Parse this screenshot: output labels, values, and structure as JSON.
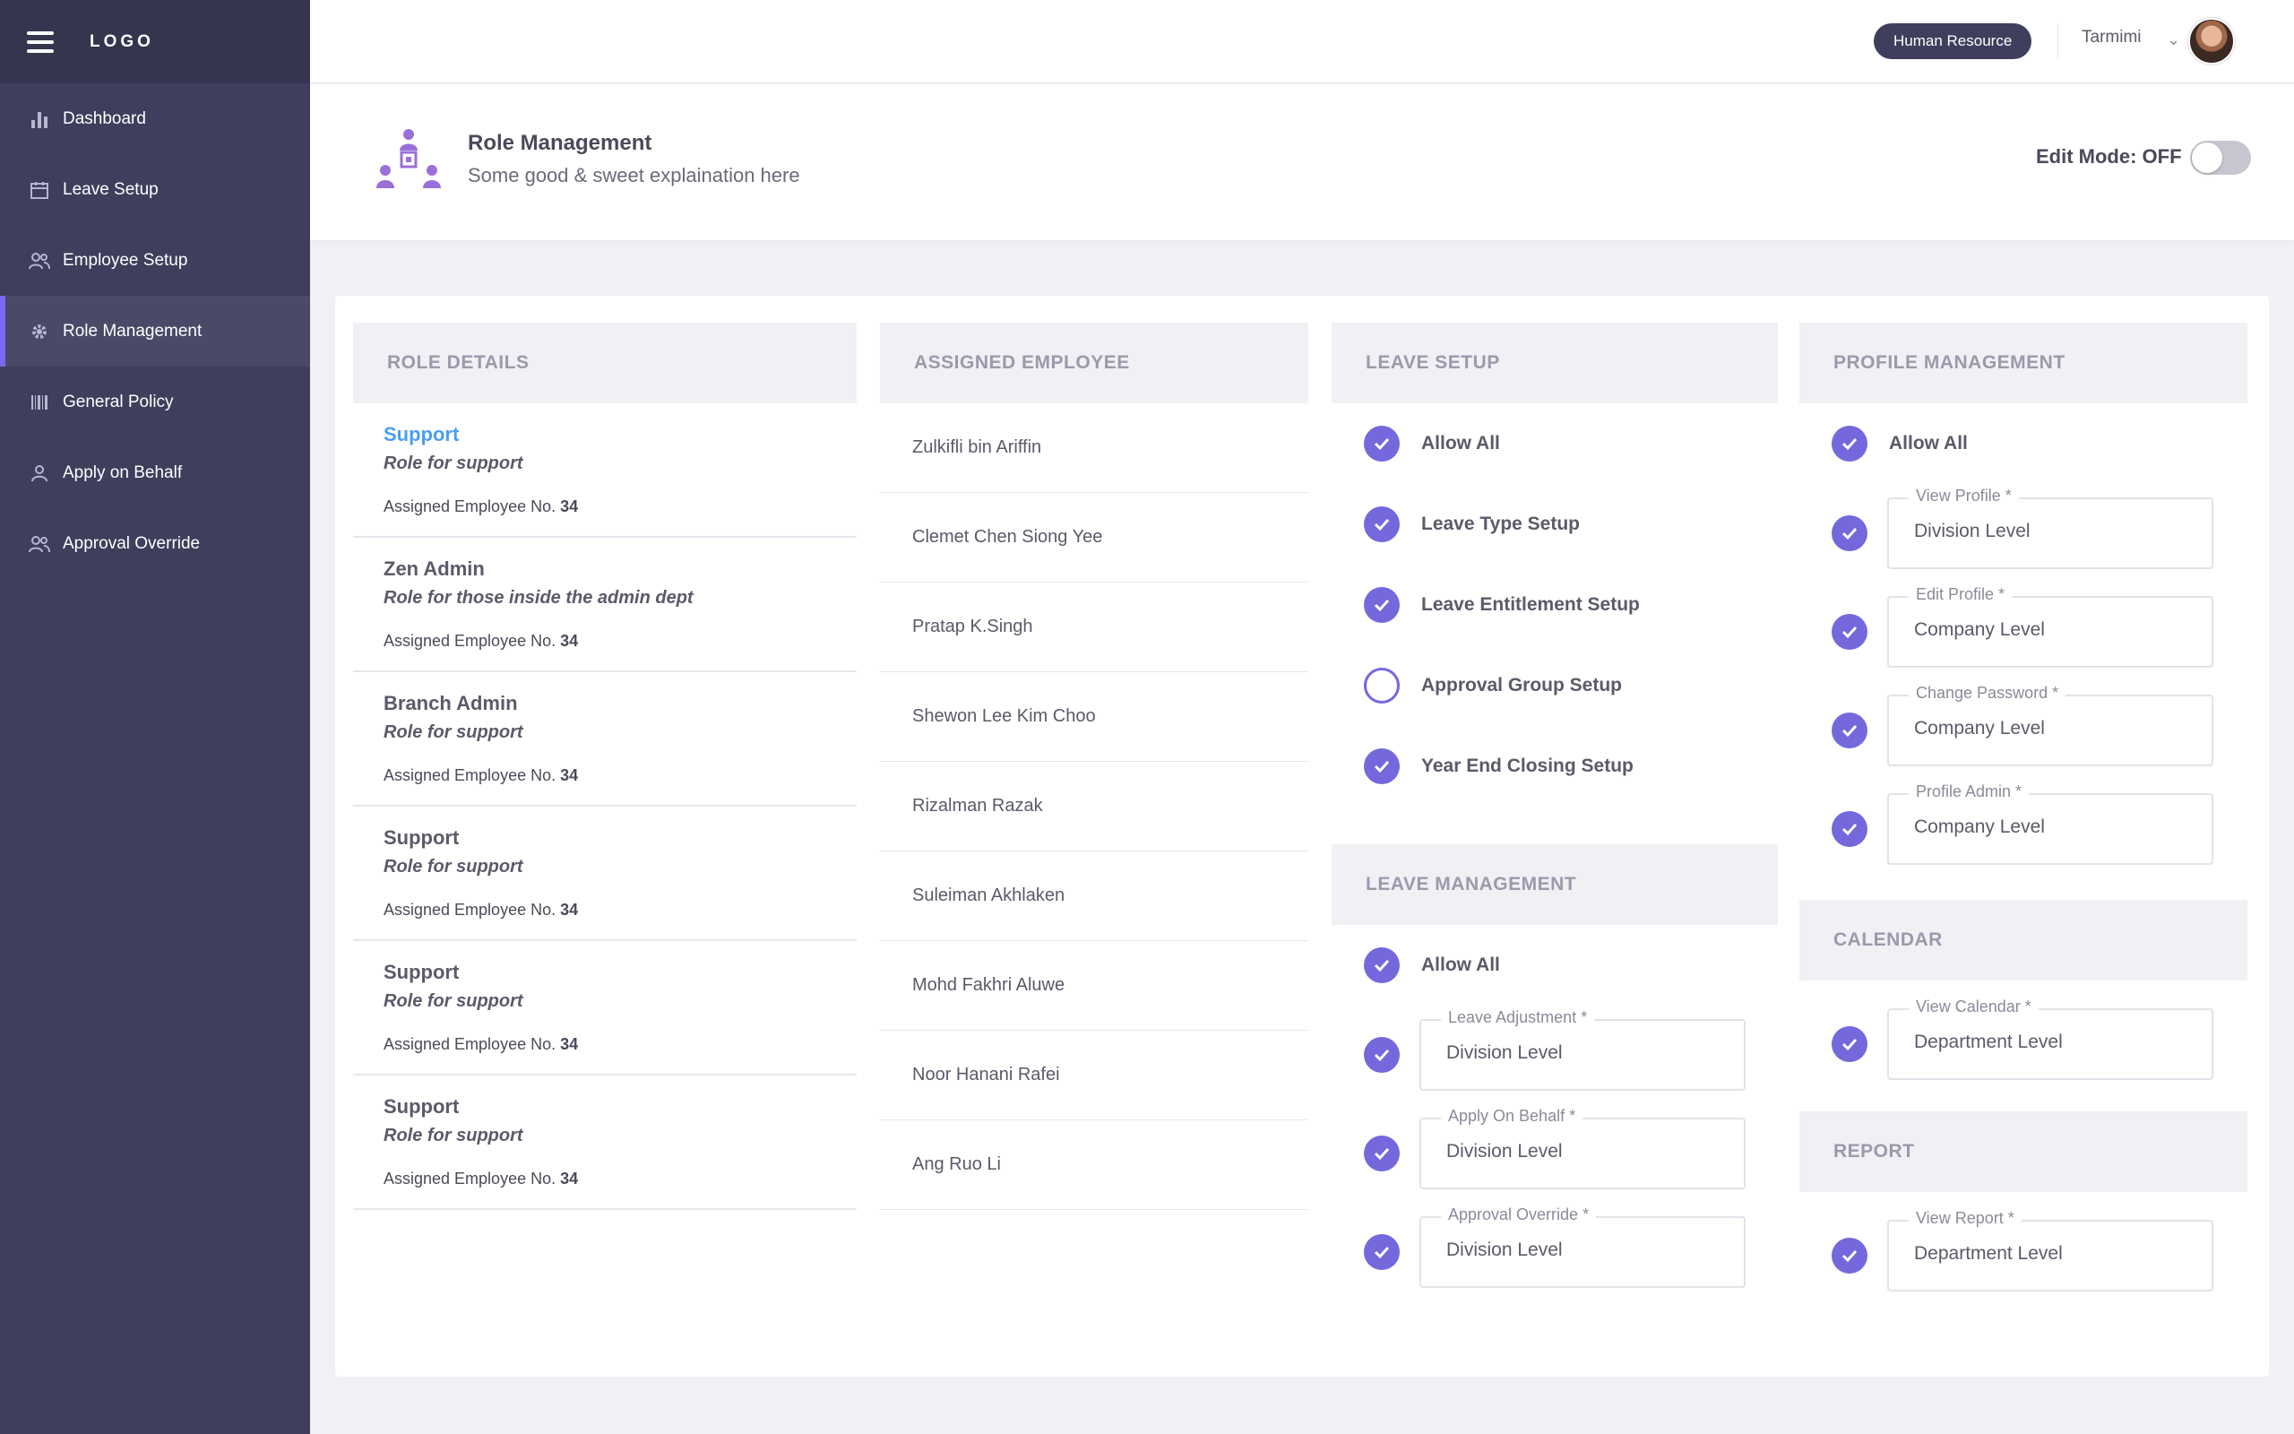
{
  "sidebar": {
    "logo": "LOGO",
    "items": [
      {
        "label": "Dashboard",
        "icon": "bar-chart-icon"
      },
      {
        "label": "Leave Setup",
        "icon": "calendar-icon"
      },
      {
        "label": "Employee Setup",
        "icon": "users-icon"
      },
      {
        "label": "Role Management",
        "icon": "gear-icon",
        "active": true
      },
      {
        "label": "General Policy",
        "icon": "barcode-icon"
      },
      {
        "label": "Apply on Behalf",
        "icon": "user-icon"
      },
      {
        "label": "Approval Override",
        "icon": "users-icon"
      }
    ]
  },
  "topbar": {
    "department": "Human Resource",
    "user_name": "Tarmimi"
  },
  "header": {
    "title": "Role Management",
    "subtitle": "Some good & sweet explaination here",
    "edit_mode_label": "Edit Mode: OFF"
  },
  "role_details": {
    "heading": "ROLE DETAILS",
    "count_label": "Assigned Employee No.",
    "roles": [
      {
        "name": "Support",
        "desc": "Role for support",
        "count": "34",
        "selected": true
      },
      {
        "name": "Zen Admin",
        "desc": "Role for those inside the admin dept",
        "count": "34"
      },
      {
        "name": "Branch Admin",
        "desc": "Role for support",
        "count": "34"
      },
      {
        "name": "Support",
        "desc": "Role for support",
        "count": "34"
      },
      {
        "name": "Support",
        "desc": "Role for support",
        "count": "34"
      },
      {
        "name": "Support",
        "desc": "Role for support",
        "count": "34"
      }
    ]
  },
  "assigned_employee": {
    "heading": "ASSIGNED EMPLOYEE",
    "employees": [
      "Zulkifli bin Ariffin",
      "Clemet Chen Siong Yee",
      "Pratap K.Singh",
      "Shewon Lee Kim Choo",
      "Rizalman Razak",
      "Suleiman Akhlaken",
      "Mohd Fakhri Aluwe",
      "Noor Hanani Rafei",
      "Ang Ruo Li"
    ]
  },
  "leave_setup": {
    "heading": "LEAVE SETUP",
    "items": [
      {
        "label": "Allow All",
        "checked": true
      },
      {
        "label": "Leave Type Setup",
        "checked": true
      },
      {
        "label": "Leave Entitlement Setup",
        "checked": true
      },
      {
        "label": "Approval Group Setup",
        "checked": false
      },
      {
        "label": "Year End Closing Setup",
        "checked": true
      }
    ]
  },
  "leave_management": {
    "heading": "LEAVE MANAGEMENT",
    "allow_all": "Allow All",
    "fields": [
      {
        "label": "Leave Adjustment *",
        "value": "Division Level"
      },
      {
        "label": "Apply On Behalf *",
        "value": "Division Level"
      },
      {
        "label": "Approval Override *",
        "value": "Division Level"
      }
    ]
  },
  "profile_management": {
    "heading": "PROFILE MANAGEMENT",
    "allow_all": "Allow All",
    "fields": [
      {
        "label": "View Profile *",
        "value": "Division Level"
      },
      {
        "label": "Edit Profile *",
        "value": "Company Level"
      },
      {
        "label": "Change Password *",
        "value": "Company Level"
      },
      {
        "label": "Profile Admin *",
        "value": "Company Level"
      }
    ]
  },
  "calendar": {
    "heading": "CALENDAR",
    "fields": [
      {
        "label": "View Calendar *",
        "value": "Department Level"
      }
    ]
  },
  "report": {
    "heading": "REPORT",
    "fields": [
      {
        "label": "View Report *",
        "value": "Department Level"
      }
    ]
  },
  "colors": {
    "sidebar": "#3f3e5c",
    "accent": "#7468dc",
    "selected_role": "#4a9eef"
  }
}
